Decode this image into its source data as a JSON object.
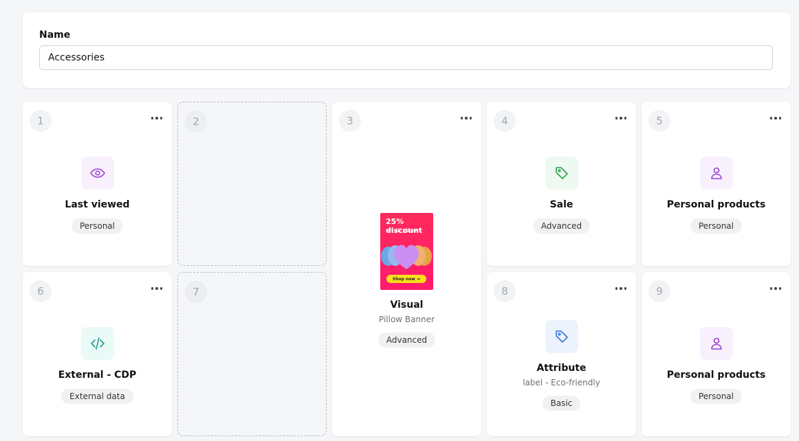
{
  "name_section": {
    "label": "Name",
    "value": "Accessories"
  },
  "slots": {
    "s1": {
      "number": "1",
      "title": "Last viewed",
      "badge": "Personal",
      "icon": "eye-icon"
    },
    "s2": {
      "number": "2"
    },
    "s3": {
      "number": "3",
      "title": "Visual",
      "subtitle": "Pillow Banner",
      "badge": "Advanced",
      "banner": {
        "headline": "25% discount",
        "subline": "on all pillows",
        "cta": "Shop now ➜"
      }
    },
    "s4": {
      "number": "4",
      "title": "Sale",
      "badge": "Advanced",
      "icon": "tag-icon"
    },
    "s5": {
      "number": "5",
      "title": "Personal products",
      "badge": "Personal",
      "icon": "user-icon"
    },
    "s6": {
      "number": "6",
      "title": "External - CDP",
      "badge": "External data",
      "icon": "code-icon"
    },
    "s7": {
      "number": "7"
    },
    "s8": {
      "number": "8",
      "title": "Attribute",
      "subtitle": "label - Eco-friendly",
      "badge": "Basic",
      "icon": "tag-icon"
    },
    "s9": {
      "number": "9",
      "title": "Personal products",
      "badge": "Personal",
      "icon": "user-icon"
    }
  },
  "colors": {
    "personal": "#9b3fd0",
    "personal_bg": "#f8f1fd",
    "sale": "#2e9d4e",
    "sale_bg": "#eefaf1",
    "code": "#1f9d8c",
    "code_bg": "#eafaf7",
    "attribute": "#3b73d8",
    "attribute_bg": "#edf3fd"
  }
}
